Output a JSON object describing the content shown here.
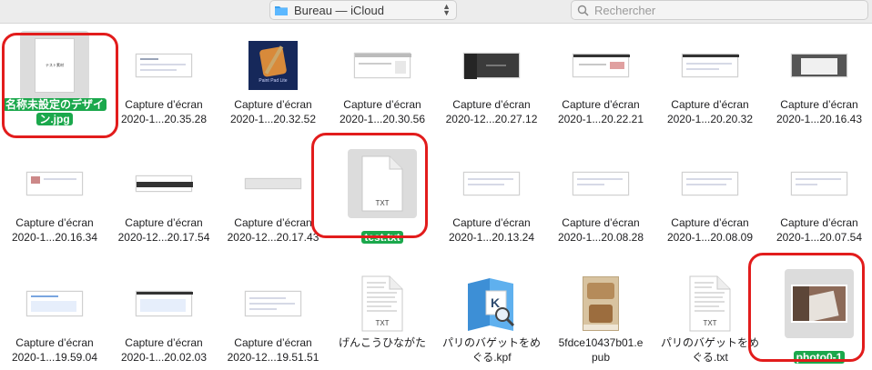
{
  "toolbar": {
    "location": "Bureau — iCloud",
    "search_placeholder": "Rechercher"
  },
  "files": [
    {
      "line1": "名称未設定のデザイ",
      "line2": "ン.jpg",
      "kind": "design",
      "selected": true
    },
    {
      "line1": "Capture d’écran",
      "line2": "2020-1...20.35.28",
      "kind": "shot-white"
    },
    {
      "line1": "Capture d’écran",
      "line2": "2020-1...20.32.52",
      "kind": "paintpad"
    },
    {
      "line1": "Capture d’écran",
      "line2": "2020-1...20.30.56",
      "kind": "shot-gray"
    },
    {
      "line1": "Capture d’écran",
      "line2": "2020-12...20.27.12",
      "kind": "shot-dark"
    },
    {
      "line1": "Capture d’écran",
      "line2": "2020-1...20.22.21",
      "kind": "shot-bar"
    },
    {
      "line1": "Capture d’écran",
      "line2": "2020-1...20.20.32",
      "kind": "shot-white"
    },
    {
      "line1": "Capture d’écran",
      "line2": "2020-1...20.16.43",
      "kind": "shot-dark2"
    },
    {
      "line1": "Capture d’écran",
      "line2": "2020-1...20.16.34",
      "kind": "shot-white"
    },
    {
      "line1": "Capture d’écran",
      "line2": "2020-12...20.17.54",
      "kind": "shot-bar"
    },
    {
      "line1": "Capture d’écran",
      "line2": "2020-12...20.17.43",
      "kind": "shot-strip"
    },
    {
      "line1": "",
      "line2": "test.txt",
      "kind": "txt",
      "selected": true
    },
    {
      "line1": "Capture d’écran",
      "line2": "2020-1...20.13.24",
      "kind": "shot-white"
    },
    {
      "line1": "Capture d’écran",
      "line2": "2020-1...20.08.28",
      "kind": "shot-white"
    },
    {
      "line1": "Capture d’écran",
      "line2": "2020-1...20.08.09",
      "kind": "shot-white"
    },
    {
      "line1": "Capture d’écran",
      "line2": "2020-1...20.07.54",
      "kind": "shot-white"
    },
    {
      "line1": "Capture d’écran",
      "line2": "2020-1...19.59.04",
      "kind": "shot-blue"
    },
    {
      "line1": "Capture d’écran",
      "line2": "2020-1...20.02.03",
      "kind": "shot-blue"
    },
    {
      "line1": "Capture d’écran",
      "line2": "2020-12...19.51.51",
      "kind": "shot-white"
    },
    {
      "line1": "げんこうひながた",
      "line2": "",
      "kind": "txt-lines"
    },
    {
      "line1": "パリのバゲットをめ",
      "line2": "ぐる.kpf",
      "kind": "kpf"
    },
    {
      "line1": "5fdce10437b01.e",
      "line2": "pub",
      "kind": "epub"
    },
    {
      "line1": "パリのバゲットをめ",
      "line2": "ぐる.txt",
      "kind": "txt-lines"
    },
    {
      "line1": "",
      "line2": "photo0-1",
      "kind": "photo",
      "selected": true
    }
  ],
  "file_type_txt": "TXT",
  "design_caption": "テスト素材",
  "paintpad_caption": "Paint Pad Lite",
  "colors": {
    "highlight": "#e21c1c",
    "selected_label_bg": "#1ba84c"
  }
}
